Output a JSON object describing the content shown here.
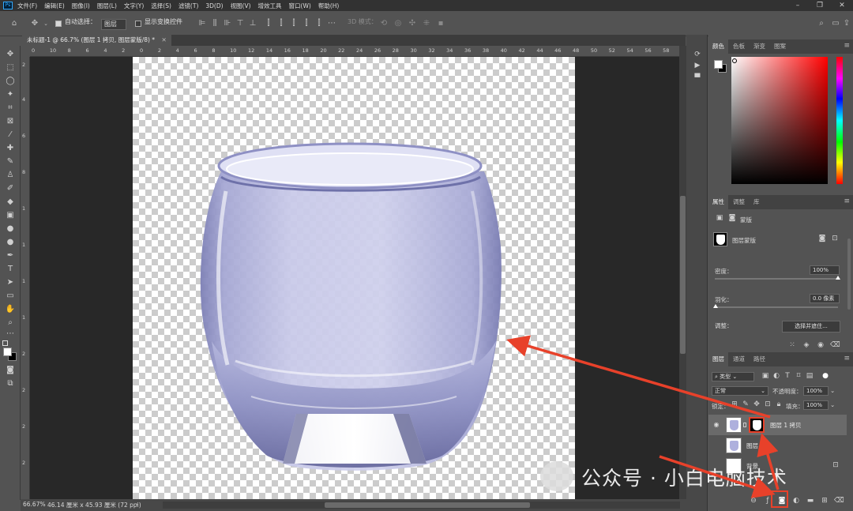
{
  "app": {
    "logo": "Ps"
  },
  "menubar": {
    "items": [
      "文件(F)",
      "编辑(E)",
      "图像(I)",
      "图层(L)",
      "文字(Y)",
      "选择(S)",
      "滤镜(T)",
      "3D(D)",
      "视图(V)",
      "增效工具",
      "窗口(W)",
      "帮助(H)"
    ]
  },
  "options": {
    "auto_select_label": "自动选择：",
    "auto_select_value": "图层",
    "show_transform_label": "显示变换控件",
    "mode_3d_label": "3D 模式："
  },
  "document": {
    "tab_title": "未标题-1 @ 66.7% (图层 1 拷贝, 图层蒙版/8) *"
  },
  "ruler": {
    "top_ticks": [
      "0",
      "10",
      "8",
      "6",
      "4",
      "2",
      "0",
      "2",
      "4",
      "6",
      "8",
      "10",
      "12",
      "14",
      "16",
      "18",
      "20",
      "22",
      "24",
      "26",
      "28",
      "30",
      "32",
      "34",
      "36",
      "38",
      "40",
      "42",
      "44",
      "46",
      "48",
      "50",
      "52",
      "54",
      "56",
      "58"
    ]
  },
  "status": {
    "zoom": "66.67%",
    "doc_info": "46.14 厘米 x 45.93 厘米 (72 ppi)"
  },
  "color_panel": {
    "tabs": [
      "颜色",
      "色板",
      "渐变",
      "图案"
    ],
    "fg": "#ffffff",
    "bg": "#000000",
    "hue": "#ff0000"
  },
  "properties_panel": {
    "tabs": [
      "属性",
      "调整",
      "库"
    ],
    "mask_label": "蒙版",
    "layer_mask_label": "图层蒙版",
    "density_label": "密度：",
    "density_value": "100%",
    "feather_label": "羽化：",
    "feather_value": "0.0 像素",
    "adjust_label": "调整：",
    "select_mask_button": "选择并遮住..."
  },
  "layers_panel": {
    "tabs": [
      "图层",
      "通道",
      "路径"
    ],
    "filter_kind": "类型",
    "blend_mode": "正常",
    "opacity_label": "不透明度：",
    "opacity_value": "100%",
    "lock_label": "锁定：",
    "fill_label": "填充：",
    "fill_value": "100%",
    "layers": [
      {
        "name": "图层 1 拷贝",
        "visible": true,
        "selected": true,
        "has_mask": true
      },
      {
        "name": "图层",
        "visible": false,
        "selected": false,
        "has_mask": false
      },
      {
        "name": "背景",
        "visible": false,
        "selected": false,
        "has_mask": false,
        "locked": true
      }
    ]
  },
  "watermark": {
    "text": "公众号 · 小白电脑技术"
  },
  "annotation_color": "#e8412a"
}
